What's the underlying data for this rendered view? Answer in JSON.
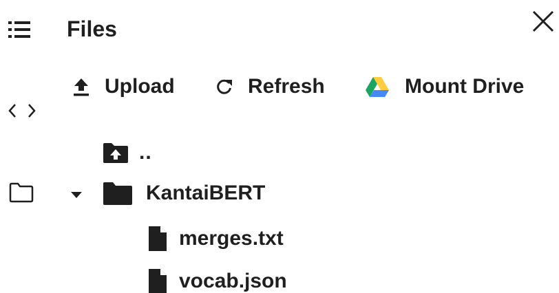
{
  "panel": {
    "title": "Files",
    "menu_icon": "list-icon",
    "close_icon": "close-icon"
  },
  "rail": {
    "items": [
      {
        "icon": "code-icon"
      },
      {
        "icon": "folder-outline-icon"
      }
    ]
  },
  "toolbar": {
    "upload_label": "Upload",
    "refresh_label": "Refresh",
    "mount_label": "Mount Drive"
  },
  "tree": {
    "parent_label": "..",
    "folder_label": "KantaiBERT",
    "files": [
      {
        "name": "merges.txt"
      },
      {
        "name": "vocab.json"
      }
    ]
  },
  "colors": {
    "text": "#1f1f1f",
    "drive_green": "#1ea362",
    "drive_blue": "#4688f4",
    "drive_yellow": "#ffcd40"
  }
}
